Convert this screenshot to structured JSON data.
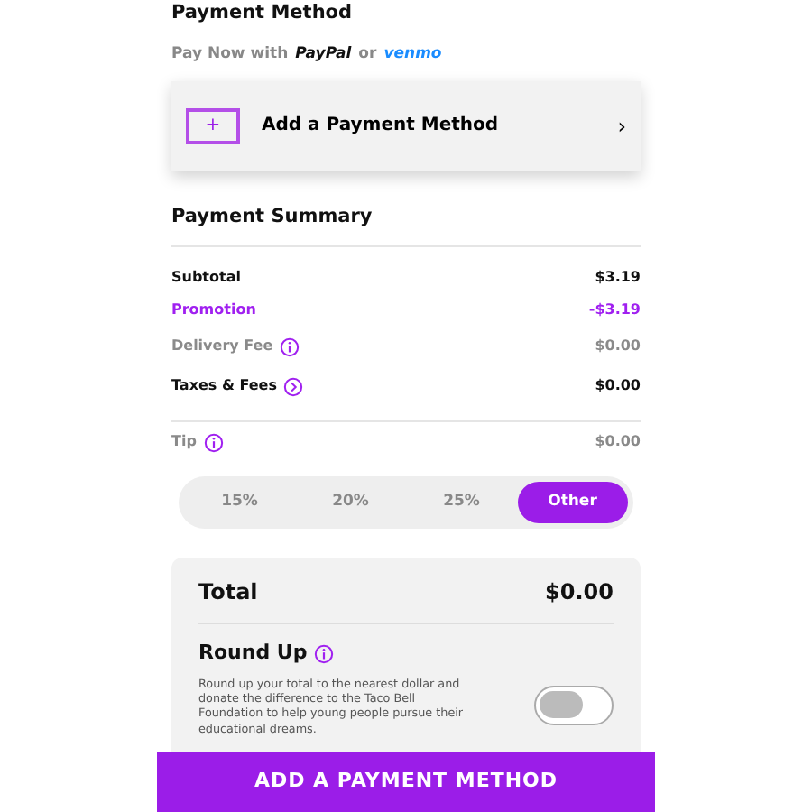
{
  "payment_method": {
    "title": "Payment Method",
    "pay_now": {
      "prefix": "Pay Now with",
      "paypal": "PayPal",
      "or": "or",
      "venmo": "venmo"
    },
    "add_card": {
      "icon": "+",
      "label": "Add a Payment Method",
      "chevron": "›"
    }
  },
  "summary": {
    "title": "Payment Summary",
    "rows": [
      {
        "label": "Subtotal",
        "value": "$3.19",
        "kind": "plain"
      },
      {
        "label": "Promotion",
        "value": "-$3.19",
        "kind": "discount"
      },
      {
        "label": "Delivery Fee",
        "value": "$0.00",
        "kind": "fee"
      },
      {
        "label": "Taxes & Fees",
        "value": "$0.00",
        "kind": "expandable"
      },
      {
        "label": "Tip",
        "value": "$0.00",
        "kind": "tip"
      }
    ]
  },
  "tip_options": [
    {
      "label": "15%",
      "selected": false
    },
    {
      "label": "20%",
      "selected": false
    },
    {
      "label": "25%",
      "selected": false
    },
    {
      "label": "Other",
      "selected": true
    }
  ],
  "total": {
    "label": "Total",
    "value": "$0.00"
  },
  "round_up": {
    "title": "Round Up",
    "description": "Round up your total to the nearest dollar and donate the difference to the Taco Bell Foundation to help young people pursue their educational dreams.",
    "on": false
  },
  "action_button": "ADD A PAYMENT METHOD"
}
